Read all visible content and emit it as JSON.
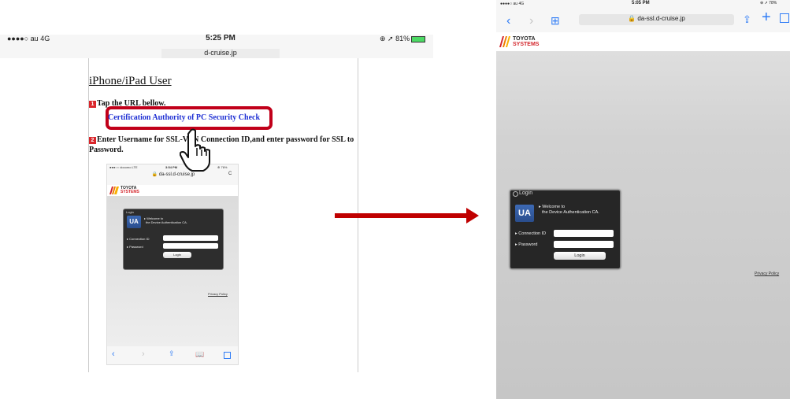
{
  "left_status": {
    "carrier": "●●●●○ au  4G",
    "time": "5:25 PM",
    "battery": "⊕ ➚ 81%",
    "url": "d-cruise.jp"
  },
  "doc": {
    "heading": "iPhone/iPad User",
    "step1_num": "1",
    "step1": "Tap the URL bellow.",
    "link": "Certification Authority of PC Security Check",
    "step2_num": "2",
    "step2": "Enter Username for SSL-VPN Connection ID,and enter password for SSL to Password."
  },
  "inset": {
    "status_left": "●●●○○ docomo  LTE",
    "status_time": "3:54 PM",
    "status_right": "⊕ 76%",
    "url": "🔒 da-ssl.d-cruise.jp",
    "reload": "C",
    "logo_top": "TOYOTA",
    "logo_bottom": "SYSTEMS",
    "login_header": "Login",
    "ua": "UA",
    "welcome_1": "▸ Welcome to",
    "welcome_2": "the Device Authentication CA.",
    "connection_label": "▸ Connection ID",
    "password_label": "▸ Password",
    "login_button": "Login",
    "privacy": "Privacy Policy"
  },
  "right": {
    "status_left": "●●●●○ au  4G",
    "status_time": "5:05 PM",
    "status_right": "⊕ ➚ 78%",
    "url": "🔒 da-ssl.d-cruise.jp",
    "reload": "C",
    "logo_top": "TOYOTA",
    "logo_bottom": "SYSTEMS",
    "login_header": "Login",
    "ua": "UA",
    "welcome_1": "▸ Welcome to",
    "welcome_2": "the Device Authentication CA.",
    "connection_label": "▸ Connection ID",
    "password_label": "▸ Password",
    "login_button": "Login",
    "privacy": "Privacy Policy"
  },
  "colors": {
    "highlight": "#c1001a",
    "link": "#1e2fd3",
    "arrow": "#c00000",
    "ios_blue": "#2f7cf6"
  }
}
